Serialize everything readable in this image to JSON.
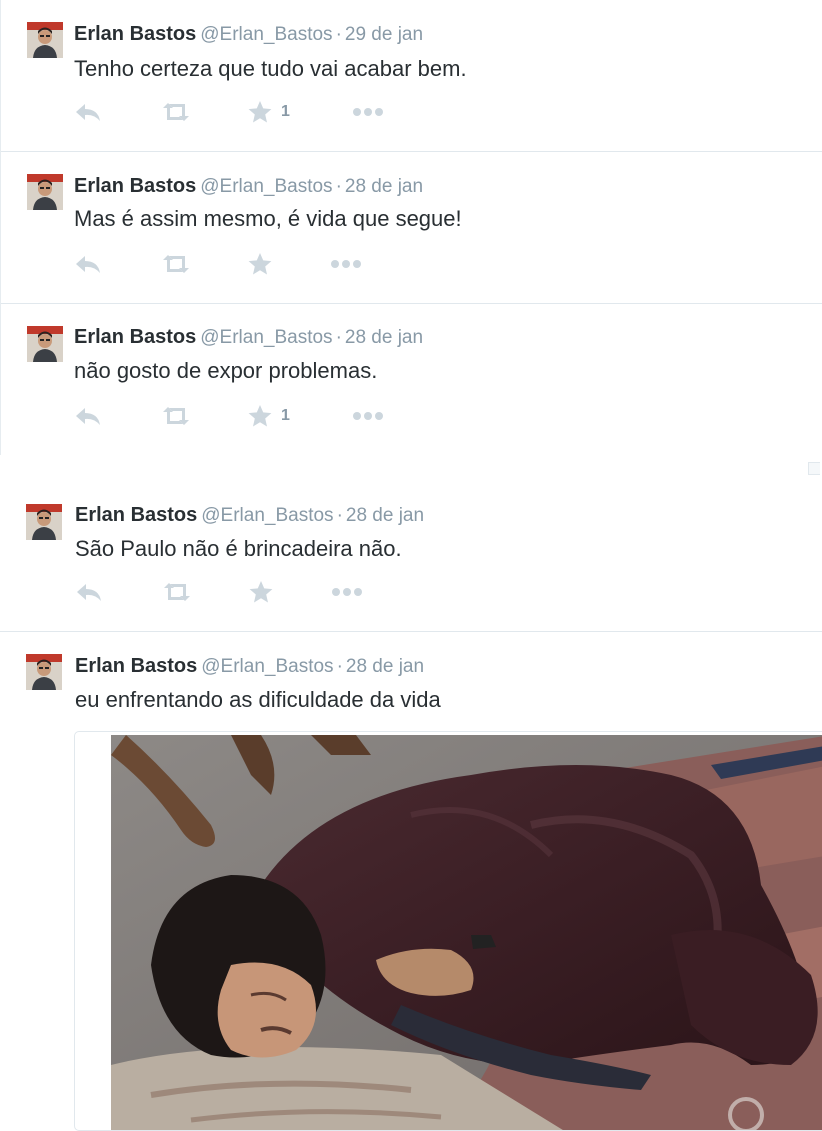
{
  "author": {
    "name": "Erlan Bastos",
    "handle": "@Erlan_Bastos",
    "separator": "·"
  },
  "tweets": [
    {
      "date": "29 de jan",
      "text": "Tenho certeza que tudo vai acabar bem.",
      "favorites": "1"
    },
    {
      "date": "28 de jan",
      "text": "Mas é assim mesmo, é vida que segue!",
      "favorites": ""
    },
    {
      "date": "28 de jan",
      "text": "não gosto de expor problemas.",
      "favorites": "1"
    },
    {
      "date": "28 de jan",
      "text": "São Paulo não é brincadeira não.",
      "favorites": ""
    },
    {
      "date": "28 de jan",
      "text": "eu enfrentando as dificuldade da vida",
      "favorites": ""
    }
  ],
  "icons": {
    "reply": "reply-icon",
    "retweet": "retweet-icon",
    "favorite": "star-icon",
    "more": "more-dots-icon"
  },
  "colors": {
    "text": "#292f33",
    "muted": "#8899a6",
    "icon": "#ccd6dd",
    "divider": "#e1e8ed"
  }
}
